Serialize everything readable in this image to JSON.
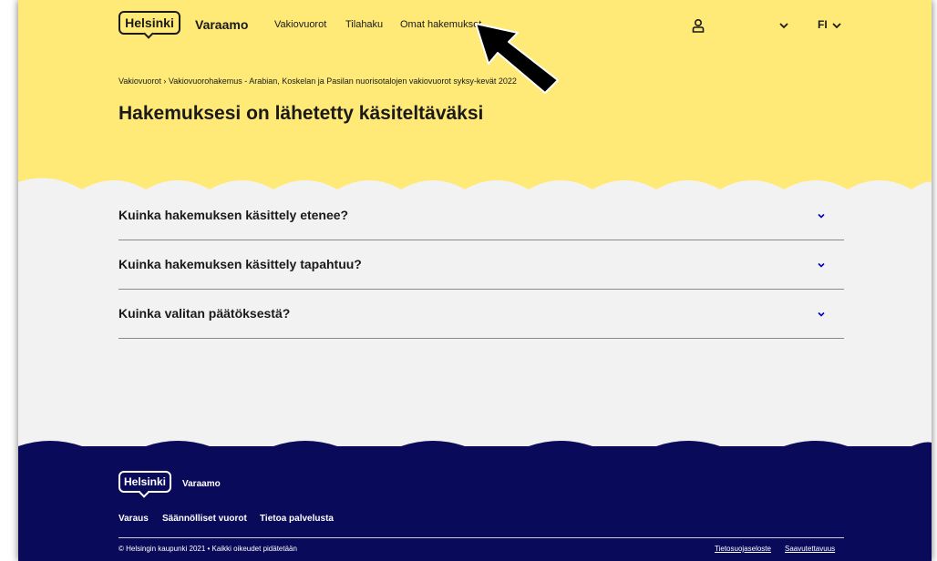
{
  "header": {
    "logo_text": "Helsinki",
    "brand": "Varaamo",
    "nav": [
      "Vakiovuorot",
      "Tilahaku",
      "Omat hakemukset"
    ],
    "language": "FI",
    "icons": [
      "user-icon",
      "chevron-down-icon"
    ]
  },
  "breadcrumb": "Vakiovuorot › Vakiovuorohakemus - Arabian, Koskelan ja Pasilan nuorisotalojen vakiovuorot syksy-kevät 2022",
  "page_title": "Hakemuksesi on lähetetty käsiteltäväksi",
  "accordion": [
    {
      "label": "Kuinka hakemuksen käsittely etenee?"
    },
    {
      "label": "Kuinka hakemuksen käsittely tapahtuu?"
    },
    {
      "label": "Kuinka valitan päätöksestä?"
    }
  ],
  "footer": {
    "logo_text": "Helsinki",
    "brand": "Varaamo",
    "links": [
      "Varaus",
      "Säännölliset vuorot",
      "Tietoa palvelusta"
    ],
    "copyright": "© Helsingin kaupunki 2021 • Kaikki oikeudet pidätetään",
    "legal_links": [
      "Tietosuojaseloste",
      "Saavutettavuus"
    ]
  },
  "colors": {
    "header_yellow": "#ffe977",
    "content_bg": "#f2f2f2",
    "footer_navy": "#0a0a5a",
    "accent_blue": "#0000bf"
  }
}
